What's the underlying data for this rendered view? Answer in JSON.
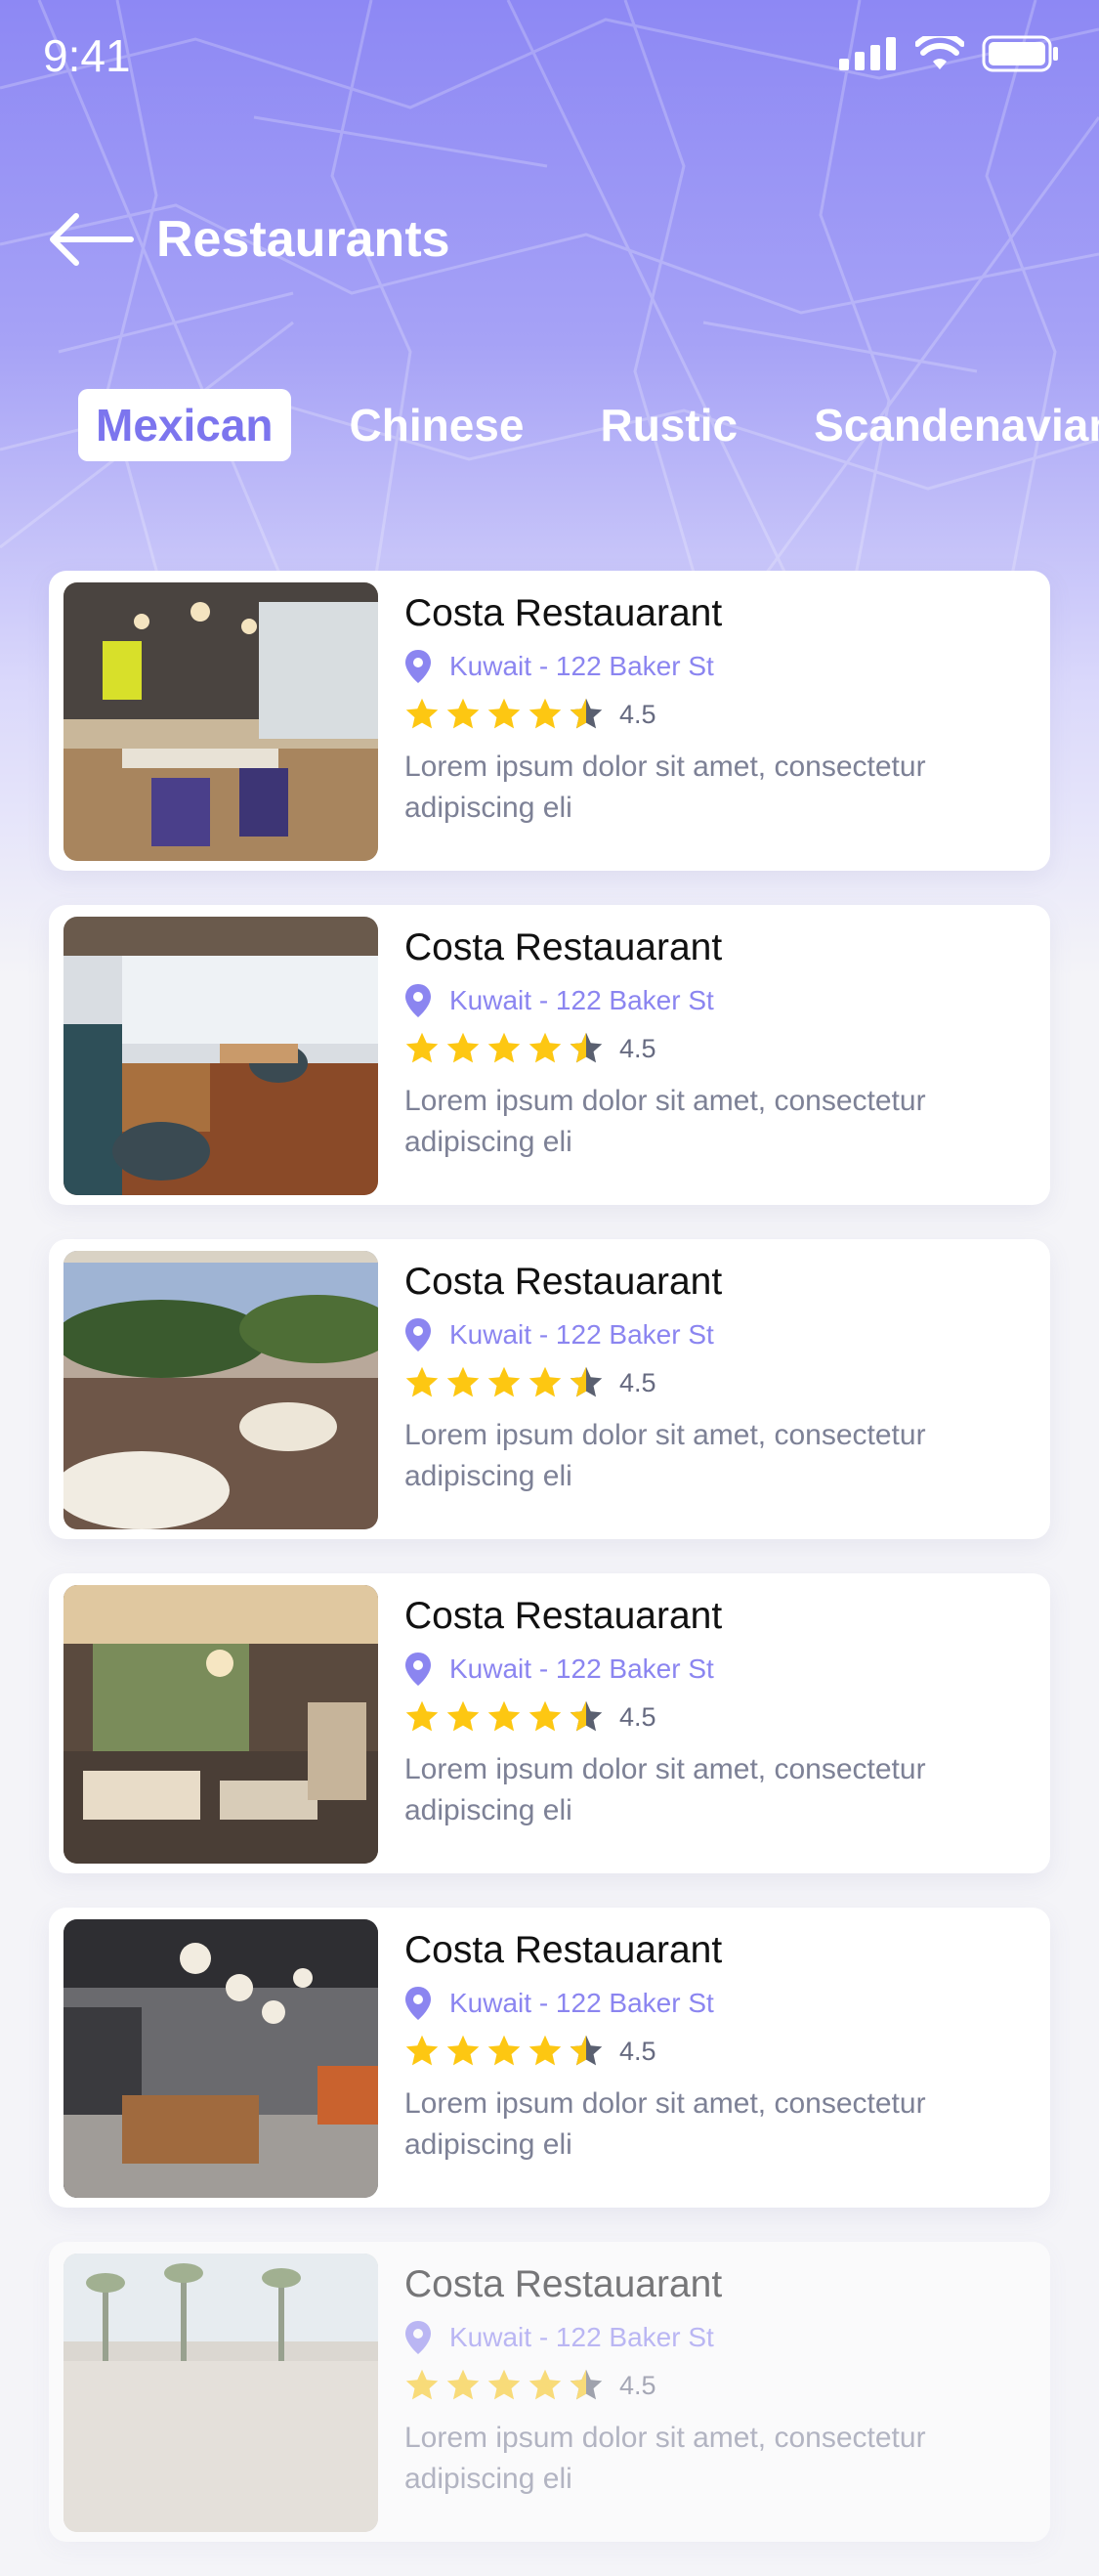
{
  "status": {
    "time": "9:41"
  },
  "header": {
    "title": "Restaurants"
  },
  "tabs": [
    {
      "label": "Mexican",
      "active": true
    },
    {
      "label": "Chinese",
      "active": false
    },
    {
      "label": "Rustic",
      "active": false
    },
    {
      "label": "Scandenavian",
      "active": false
    }
  ],
  "restaurants": [
    {
      "name": "Costa Restauarant",
      "address": "Kuwait - 122 Baker St",
      "rating": "4.5",
      "description": "Lorem ipsum dolor sit amet, consectetur adipiscing eli"
    },
    {
      "name": "Costa Restauarant",
      "address": "Kuwait - 122 Baker St",
      "rating": "4.5",
      "description": "Lorem ipsum dolor sit amet, consectetur adipiscing eli"
    },
    {
      "name": "Costa Restauarant",
      "address": "Kuwait - 122 Baker St",
      "rating": "4.5",
      "description": "Lorem ipsum dolor sit amet, consectetur adipiscing eli"
    },
    {
      "name": "Costa Restauarant",
      "address": "Kuwait - 122 Baker St",
      "rating": "4.5",
      "description": "Lorem ipsum dolor sit amet, consectetur adipiscing eli"
    },
    {
      "name": "Costa Restauarant",
      "address": "Kuwait - 122 Baker St",
      "rating": "4.5",
      "description": "Lorem ipsum dolor sit amet, consectetur adipiscing eli"
    },
    {
      "name": "Costa Restauarant",
      "address": "Kuwait - 122 Baker St",
      "rating": "4.5",
      "description": "Lorem ipsum dolor sit amet, consectetur adipiscing eli"
    }
  ],
  "colors": {
    "accent": "#8b85f0",
    "star": "#fdc712",
    "header": "#8d88f4"
  },
  "icons": [
    "back-arrow-icon",
    "signal-icon",
    "wifi-icon",
    "battery-icon",
    "location-pin-icon",
    "star-icon"
  ]
}
